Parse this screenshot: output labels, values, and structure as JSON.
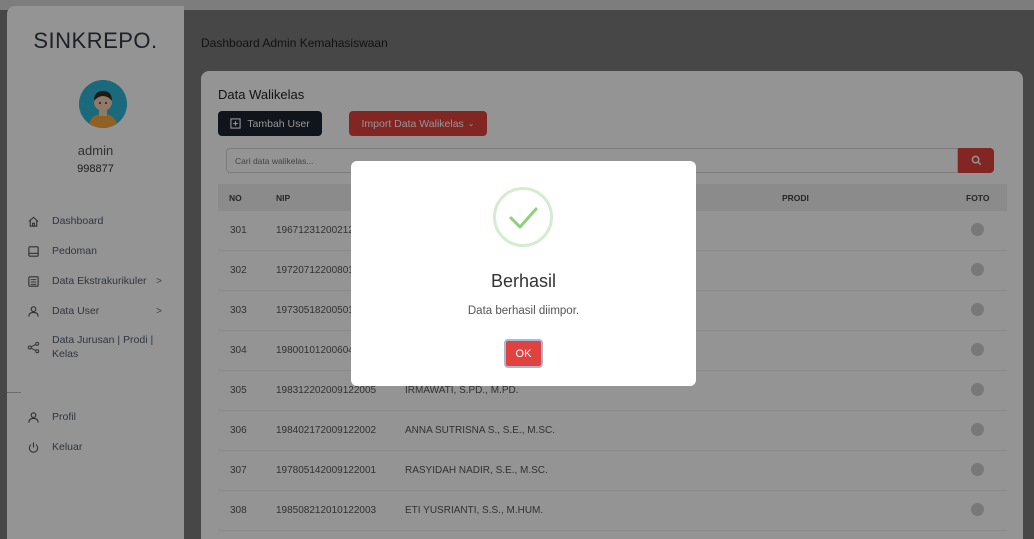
{
  "sidebar": {
    "brand": "SINKREPO.",
    "user_name": "admin",
    "user_id": "998877",
    "items": [
      {
        "label": "Dashboard",
        "icon": "home-icon",
        "has_submenu": false
      },
      {
        "label": "Pedoman",
        "icon": "book-icon",
        "has_submenu": false
      },
      {
        "label": "Data Ekstrakurikuler",
        "icon": "list-icon",
        "has_submenu": true
      },
      {
        "label": "Data User",
        "icon": "user-icon",
        "has_submenu": true
      },
      {
        "label_line1": "Data Jurusan | Prodi |",
        "label_line2": "Kelas",
        "icon": "share-icon",
        "has_submenu": false
      }
    ],
    "bottom_items": [
      {
        "label": "Profil",
        "icon": "user-icon"
      },
      {
        "label": "Keluar",
        "icon": "power-icon"
      }
    ],
    "submenu_chevron": ">"
  },
  "header": {
    "title": "Dashboard Admin Kemahasiswaan"
  },
  "card": {
    "title": "Data Walikelas",
    "add_button": "Tambah User",
    "import_button": "Import Data Walikelas",
    "search_placeholder": "Cari data walikelas...",
    "columns": {
      "no": "NO",
      "nip": "NIP",
      "prodi": "PRODI",
      "foto": "FOTO"
    },
    "rows": [
      {
        "no": "301",
        "nip": "19671231200212",
        "name": ""
      },
      {
        "no": "302",
        "nip": "19720712200801",
        "name": ""
      },
      {
        "no": "303",
        "nip": "19730518200501",
        "name": ""
      },
      {
        "no": "304",
        "nip": "19800101200604",
        "name": ""
      },
      {
        "no": "305",
        "nip": "198312202009122005",
        "name": "IRMAWATI, S.PD., M.PD."
      },
      {
        "no": "306",
        "nip": "198402172009122002",
        "name": "ANNA SUTRISNA S., S.E., M.SC."
      },
      {
        "no": "307",
        "nip": "197805142009122001",
        "name": "RASYIDAH NADIR, S.E., M.SC."
      },
      {
        "no": "308",
        "nip": "198508212010122003",
        "name": "ETI YUSRIANTI, S.S., M.HUM."
      }
    ]
  },
  "modal": {
    "title": "Berhasil",
    "message": "Data berhasil diimpor.",
    "ok_button": "OK"
  },
  "colors": {
    "accent_red": "#e0433f",
    "dark_button": "#1c2330",
    "success_check": "#8fd07f",
    "avatar_bg": "#2eb6d8"
  }
}
